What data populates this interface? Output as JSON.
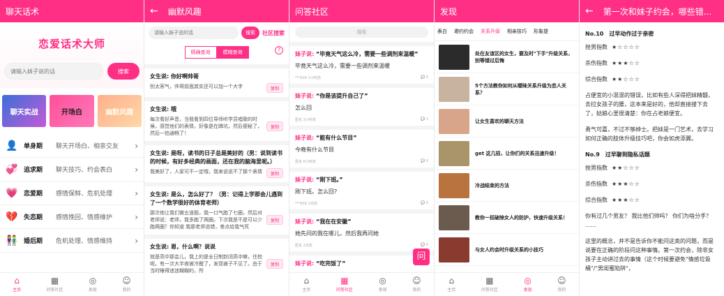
{
  "s1": {
    "title": "聊天话术",
    "hero_title": "恋爱话术大师",
    "search_placeholder": "请输入妹子说的话",
    "search_button": "搜索",
    "cards": [
      "聊天实战",
      "开场白",
      "幽默风趣"
    ],
    "stages": [
      {
        "icon": "person-icon",
        "glyph": "👤",
        "name": "单身期",
        "desc": "聊天开场白、相亲交友"
      },
      {
        "icon": "hearts-icon",
        "glyph": "💞",
        "name": "追求期",
        "desc": "聊天技巧、约会表白"
      },
      {
        "icon": "love-icon",
        "glyph": "💗",
        "name": "恋爱期",
        "desc": "感情保鲜、危机处理"
      },
      {
        "icon": "broken-heart-icon",
        "glyph": "💔",
        "name": "失恋期",
        "desc": "感情挽回、情感维护"
      },
      {
        "icon": "couple-icon",
        "glyph": "👫",
        "name": "婚后期",
        "desc": "危机处理、情感维持"
      }
    ]
  },
  "tabs": [
    "主页",
    "问答社区",
    "发现",
    "我的"
  ],
  "s2": {
    "title": "幽默风趣",
    "search_placeholder": "请输入妹子说的话",
    "search_button": "搜索",
    "community_search": "社区搜索",
    "seg": [
      "精确查询",
      "模糊查询"
    ],
    "copy_label": "复制",
    "items": [
      {
        "q": "女生说: 你好啊帅哥",
        "a": "别太客气，帅哥前面其实还可以加一个大字"
      },
      {
        "q": "女生说: 哦",
        "a": "每次看好声音，当我看到四位导师听学员唱歌的时候，感觉他们的表情，好像是在蹲坑，然后便秘了，然后一拍通畅了！"
      },
      {
        "q": "女生说: 是呀，读书的日子总是美好的（男：说到读书的时候，有好多经典的画面，还在我的脑海里呢。）",
        "a": "我美好了，人家可不一定哦，我来说说不了那个表情"
      },
      {
        "q": "女生说: 是么，怎么好了？（男：记得上学那会儿遇到了一个数学很好的体育老师）",
        "a": "那次他让我们做五道题，我一口气跑了七圈，然后对老师说：老师，我多跑了两圈。下次我是不是可以少跑两圈？你知道 我那老师说错，差点给我气死"
      },
      {
        "q": "女生说: 恩，什么啊？说说",
        "a": "就是高中那会儿，我上的是全日制封闭高中嘛，住校 呢。有一次大半夜被冷醒了，发现被子不见了。由于当时睡得迷迷糊糊的，所"
      }
    ]
  },
  "s3": {
    "title": "问答社区",
    "search_placeholder": "搜索",
    "who": "妹子说:",
    "float": "问",
    "posts": [
      {
        "q": "毕竟天气这么冷，需要一些调剂来温暖",
        "a": "毕竟天气这么冷，需要一些调剂来温暖",
        "meta": "***616 1小时前",
        "count": "0"
      },
      {
        "q": "你是该提升自己了",
        "a": "怎么回",
        "meta": "匿名 3小时前",
        "count": "1"
      },
      {
        "q": "能有什么节目",
        "a": "今晚有什么节目",
        "meta": "匿名 6小时前",
        "count": "0"
      },
      {
        "q": "刚下班。",
        "a": "刚下班。怎么回?",
        "meta": "***616 1天前",
        "count": "0"
      },
      {
        "q": "我在在安徽",
        "a": "她先问的我在哪儿，然后我再问她",
        "meta": "匿名 2天前",
        "count": "0"
      },
      {
        "q": "吃完饭了",
        "a": "",
        "meta": "",
        "count": ""
      }
    ]
  },
  "s4": {
    "title": "发现",
    "categories": [
      "表白",
      "邀约约会",
      "关系升级",
      "相亲技巧",
      "形象提"
    ],
    "selected_category": 2,
    "articles": [
      {
        "title": "处在友谊区的女生，要及时\"下手\"升级关系，别等错过后悔",
        "color": "#2b2b2b"
      },
      {
        "title": "5个方法教你如何从暧昧关系升级为恋人关系？",
        "color": "#c7b3a0"
      },
      {
        "title": "让女生喜欢的聊天方法",
        "color": "#d9a58a"
      },
      {
        "title": "get 这几招，让你们的关系迅速升级！",
        "color": "#a8956a"
      },
      {
        "title": "冷战结束的方法",
        "color": "#b8733e"
      },
      {
        "title": "教你一招破除女人的防护，快速升级关系！",
        "color": "#6b5a4e"
      },
      {
        "title": "与女人约会时升级关系的小技巧",
        "color": "#8a3b2f"
      }
    ]
  },
  "s5": {
    "title": "第一次和妹子约会，哪些错...",
    "sections": [
      {
        "heading": "No.10　过早动作过于亲密",
        "idx": [
          [
            "挫男指数",
            "★☆☆☆☆"
          ],
          [
            "杀伤指数",
            "★★★☆☆"
          ],
          [
            "综合指数",
            "★★☆☆☆"
          ]
        ],
        "paras": [
          "占便宜的小混混的错误，比如有些人深得把妹精髓，去拉女孩子的腰，这本来是好的，他却直接搂下去了，姑娘心里很清楚：你在占老娘便宜。",
          "勇气可嘉，不过不够绅士。把妹是一门艺术，去学习如何正确的肢体升级技巧吧，你会如虎添翼。"
        ]
      },
      {
        "heading": "No.9　过早聊到隐私话题",
        "idx": [
          [
            "挫男指数",
            "★★☆☆☆"
          ],
          [
            "杀伤指数",
            "★★★☆☆"
          ],
          [
            "综合指数",
            "★★★☆☆"
          ]
        ],
        "paras": [
          "你有过几个男友？ 我比他们帅吗？ 你们为啥分手？ ……",
          "这里的概念，并不是告诉你不能问这类的问题，而是说要在正确的阶段问这种事情。第一次约会，除非女孩子主动讲过去的事情（这个时候要避免\"情感垃圾桶\"/\"男闺蜜陷阱\"，"
        ]
      }
    ]
  }
}
